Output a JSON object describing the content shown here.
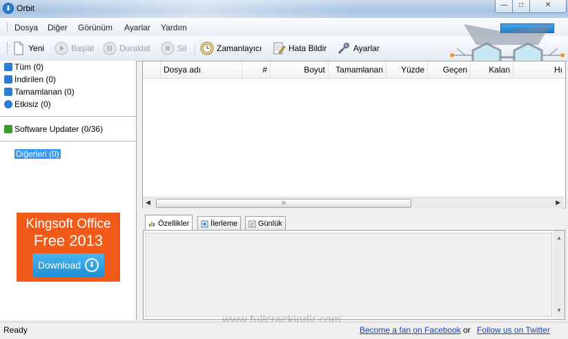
{
  "window": {
    "title": "Orbit",
    "controls": {
      "minimize": "—",
      "maximize": "□",
      "close": "✕"
    }
  },
  "menu": [
    "Dosya",
    "Diğer",
    "Görünüm",
    "Ayarlar",
    "Yardım"
  ],
  "toolbar": {
    "new": "Yeni",
    "start": "Başlat",
    "pause": "Duraklat",
    "delete": "Sil",
    "scheduler": "Zamanlayıcı",
    "report_error": "Hata Bildir",
    "settings": "Ayarlar"
  },
  "sidebar": {
    "items": [
      {
        "label": "Tüm (0)",
        "icon": "list-icon",
        "color": "#2a7fd4"
      },
      {
        "label": "İndirilen (0)",
        "icon": "download-arrow-icon",
        "color": "#2a7fd4"
      },
      {
        "label": "Tamamlanan (0)",
        "icon": "completed-icon",
        "color": "#2a7fd4"
      },
      {
        "label": "Etkisiz (0)",
        "icon": "inactive-icon",
        "color": "#2a7fd4"
      }
    ],
    "updater": {
      "label": "Software Updater (0/36)",
      "icon": "updater-icon",
      "color": "#3a9a2a"
    },
    "other": {
      "label": "Diğerleri (0)"
    }
  },
  "ad": {
    "line1": "Kingsoft Office",
    "line2": "Free 2013",
    "button": "Download",
    "color": "#f25a1a"
  },
  "list": {
    "columns": [
      "Dosya adı",
      "#",
      "Boyut",
      "Tamamlanan",
      "Yüzde",
      "Geçen",
      "Kalan",
      "Hı"
    ],
    "scroll_thumb": "III"
  },
  "tabs": [
    "Özellikler",
    "İlerleme",
    "Günlük"
  ],
  "status": {
    "text": "Ready",
    "facebook": "Become a fan on Facebook",
    "or": "or",
    "twitter": "Follow us on Twitter"
  },
  "watermark": "www.fullcrackindir.com"
}
